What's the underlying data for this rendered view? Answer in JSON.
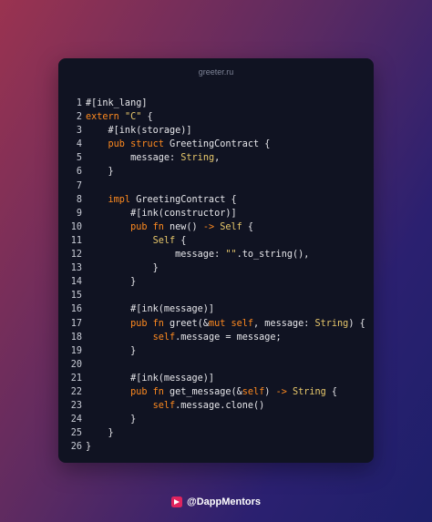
{
  "window": {
    "filename": "greeter.ru"
  },
  "code": {
    "lines": [
      {
        "n": "1",
        "t": [
          {
            "c": "p",
            "v": "#[ink_lang]"
          }
        ]
      },
      {
        "n": "2",
        "t": [
          {
            "c": "k",
            "v": "extern "
          },
          {
            "c": "s",
            "v": "\"C\""
          },
          {
            "c": "p",
            "v": " {"
          }
        ]
      },
      {
        "n": "3",
        "t": [
          {
            "c": "p",
            "v": "    #[ink(storage)]"
          }
        ]
      },
      {
        "n": "4",
        "t": [
          {
            "c": "k",
            "v": "    pub struct "
          },
          {
            "c": "p",
            "v": "GreetingContract {"
          }
        ]
      },
      {
        "n": "5",
        "t": [
          {
            "c": "p",
            "v": "        message: "
          },
          {
            "c": "s",
            "v": "String"
          },
          {
            "c": "p",
            "v": ","
          }
        ]
      },
      {
        "n": "6",
        "t": [
          {
            "c": "p",
            "v": "    }"
          }
        ]
      },
      {
        "n": "7",
        "t": []
      },
      {
        "n": "8",
        "t": [
          {
            "c": "k",
            "v": "    impl "
          },
          {
            "c": "p",
            "v": "GreetingContract {"
          }
        ]
      },
      {
        "n": "9",
        "t": [
          {
            "c": "p",
            "v": "        #[ink(constructor)]"
          }
        ]
      },
      {
        "n": "10",
        "t": [
          {
            "c": "k",
            "v": "        pub fn "
          },
          {
            "c": "p",
            "v": "new() "
          },
          {
            "c": "k",
            "v": "-> "
          },
          {
            "c": "s",
            "v": "Self"
          },
          {
            "c": "p",
            "v": " {"
          }
        ]
      },
      {
        "n": "11",
        "t": [
          {
            "c": "s",
            "v": "            Self"
          },
          {
            "c": "p",
            "v": " {"
          }
        ]
      },
      {
        "n": "12",
        "t": [
          {
            "c": "p",
            "v": "                message: "
          },
          {
            "c": "s",
            "v": "\"\""
          },
          {
            "c": "p",
            "v": ".to_string(),"
          }
        ]
      },
      {
        "n": "13",
        "t": [
          {
            "c": "p",
            "v": "            }"
          }
        ]
      },
      {
        "n": "14",
        "t": [
          {
            "c": "p",
            "v": "        }"
          }
        ]
      },
      {
        "n": "15",
        "t": []
      },
      {
        "n": "16",
        "t": [
          {
            "c": "p",
            "v": "        #[ink(message)]"
          }
        ]
      },
      {
        "n": "17",
        "t": [
          {
            "c": "k",
            "v": "        pub fn "
          },
          {
            "c": "p",
            "v": "greet(&"
          },
          {
            "c": "k",
            "v": "mut self"
          },
          {
            "c": "p",
            "v": ", message: "
          },
          {
            "c": "s",
            "v": "String"
          },
          {
            "c": "p",
            "v": ") {"
          }
        ]
      },
      {
        "n": "18",
        "t": [
          {
            "c": "k",
            "v": "            self"
          },
          {
            "c": "p",
            "v": ".message = message;"
          }
        ]
      },
      {
        "n": "19",
        "t": [
          {
            "c": "p",
            "v": "        }"
          }
        ]
      },
      {
        "n": "20",
        "t": []
      },
      {
        "n": "21",
        "t": [
          {
            "c": "p",
            "v": "        #[ink(message)]"
          }
        ]
      },
      {
        "n": "22",
        "t": [
          {
            "c": "k",
            "v": "        pub fn "
          },
          {
            "c": "p",
            "v": "get_message(&"
          },
          {
            "c": "k",
            "v": "self"
          },
          {
            "c": "p",
            "v": ") "
          },
          {
            "c": "k",
            "v": "-> "
          },
          {
            "c": "s",
            "v": "String"
          },
          {
            "c": "p",
            "v": " {"
          }
        ]
      },
      {
        "n": "23",
        "t": [
          {
            "c": "k",
            "v": "            self"
          },
          {
            "c": "p",
            "v": ".message.clone()"
          }
        ]
      },
      {
        "n": "24",
        "t": [
          {
            "c": "p",
            "v": "        }"
          }
        ]
      },
      {
        "n": "25",
        "t": [
          {
            "c": "p",
            "v": "    }"
          }
        ]
      },
      {
        "n": "26",
        "t": [
          {
            "c": "p",
            "v": "}"
          }
        ]
      }
    ]
  },
  "footer": {
    "handle": "@DappMentors",
    "logo_icon": "dappmentors-logo-icon"
  }
}
